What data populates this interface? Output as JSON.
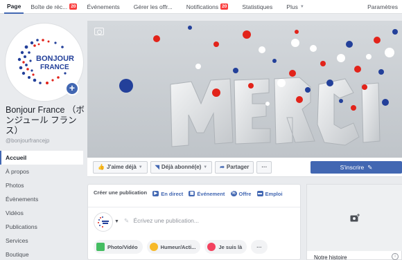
{
  "topnav": {
    "items": [
      {
        "label": "Page",
        "active": true
      },
      {
        "label": "Boîte de réc...",
        "badge": "20"
      },
      {
        "label": "Événements"
      },
      {
        "label": "Gérer les offr..."
      },
      {
        "label": "Notifications",
        "badge": "20"
      },
      {
        "label": "Statistiques"
      },
      {
        "label": "Plus",
        "caret": true
      },
      {
        "label": "Paramètres"
      }
    ]
  },
  "profile": {
    "logo_line1": "BONJOUR",
    "logo_line2": "FRANCE",
    "add_icon": "+",
    "name": "Bonjour France （ボンジュール フランス）",
    "handle": "@bonjourfrancejp"
  },
  "sidebar": {
    "items": [
      {
        "label": "Accueil",
        "active": true
      },
      {
        "label": "À propos"
      },
      {
        "label": "Photos"
      },
      {
        "label": "Évènements"
      },
      {
        "label": "Vidéos"
      },
      {
        "label": "Publications"
      },
      {
        "label": "Services"
      },
      {
        "label": "Boutique"
      }
    ]
  },
  "cover": {
    "word": "MERCI",
    "colors": {
      "red": "#e2231a",
      "blue": "#23409a",
      "white": "#ffffff",
      "bg": "#c9ced3"
    }
  },
  "actionbar": {
    "like_label": "J'aime déjà",
    "follow_label": "Déjà abonné(e)",
    "share_label": "Partager",
    "more_label": "···",
    "signup_label": "S'inscrire"
  },
  "composer": {
    "tabs": [
      {
        "label": "Créer une publication",
        "icon": "none"
      },
      {
        "label": "En direct",
        "icon": "live-icon",
        "color": "#4267b2"
      },
      {
        "label": "Événement",
        "icon": "calendar-icon",
        "color": "#4267b2"
      },
      {
        "label": "Offre",
        "icon": "offer-icon",
        "color": "#4267b2"
      },
      {
        "label": "Emploi",
        "icon": "job-icon",
        "color": "#4267b2"
      }
    ],
    "placeholder": "Écrivez une publication...",
    "pills": [
      {
        "label": "Photo/Vidéo",
        "icon": "photo-icon",
        "color": "#45bd62"
      },
      {
        "label": "Humeur/Acti...",
        "icon": "emoji-icon",
        "color": "#f7b928"
      },
      {
        "label": "Je suis là",
        "icon": "location-icon",
        "color": "#f3425f"
      },
      {
        "label": "···",
        "icon": "none"
      }
    ]
  },
  "rightcard": {
    "story_label": "Notre histoire",
    "photo_icon": "add-photo-icon"
  },
  "colors": {
    "accent": "#4267b2",
    "badge": "#fa3e3e",
    "bg": "#e9ebee"
  }
}
